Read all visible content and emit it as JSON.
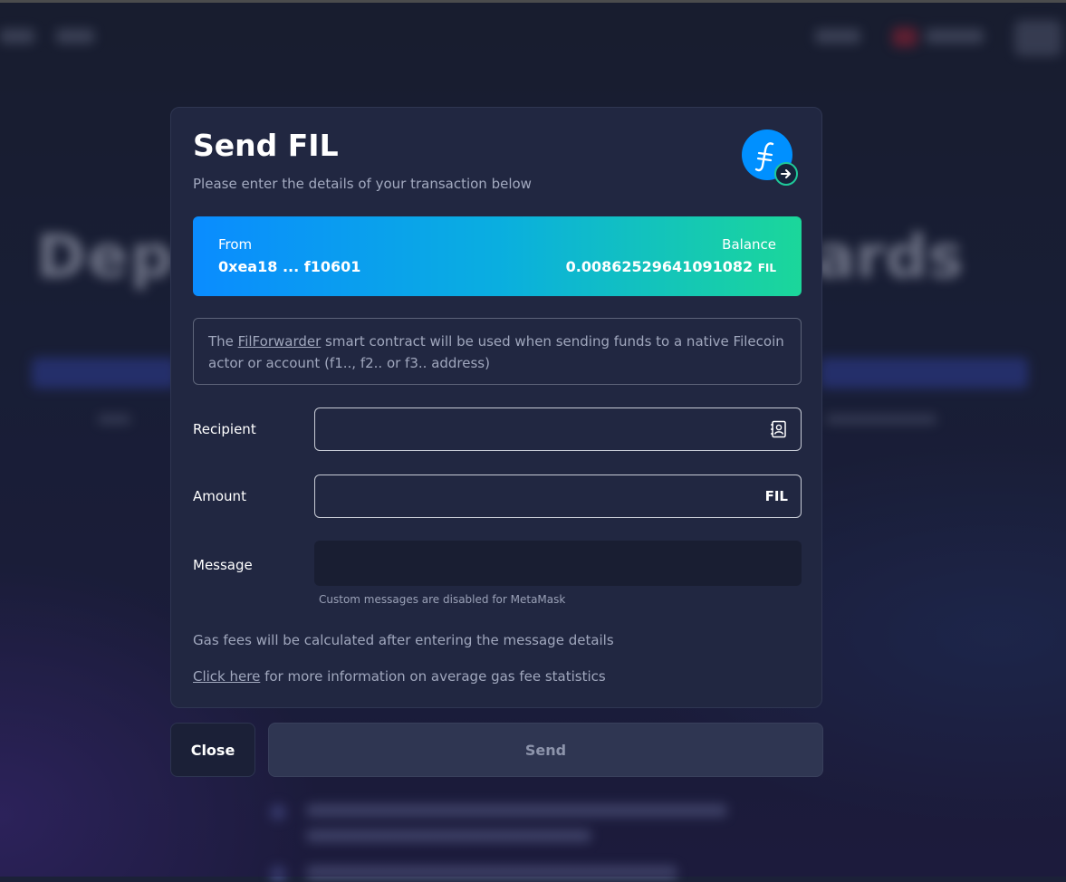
{
  "modal": {
    "title": "Send FIL",
    "subtitle": "Please enter the details of your transaction below"
  },
  "balance_card": {
    "from_label": "From",
    "from_value": "0xea18 ... f10601",
    "balance_label": "Balance",
    "balance_value": "0.00862529641091082",
    "balance_unit": "FIL"
  },
  "notice": {
    "prefix": "The ",
    "link": "FilForwarder",
    "suffix": " smart contract will be used when sending funds to a native Filecoin actor or account (f1.., f2.. or f3.. address)"
  },
  "form": {
    "recipient_label": "Recipient",
    "recipient_value": "",
    "amount_label": "Amount",
    "amount_value": "",
    "amount_unit": "FIL",
    "message_label": "Message",
    "message_helper": "Custom messages are disabled for MetaMask"
  },
  "gas": {
    "note": "Gas fees will be calculated after entering the message details",
    "link": "Click here",
    "link_suffix": " for more information on average gas fee statistics"
  },
  "buttons": {
    "close": "Close",
    "send": "Send"
  },
  "colors": {
    "modal_bg": "#212741",
    "gradient_start": "#0a8cff",
    "gradient_end": "#1bd79a",
    "filecoin_blue": "#0090ff",
    "badge_green": "#1fc99a"
  },
  "icons": {
    "logo": "filecoin-logo-icon",
    "badge": "arrow-right-circle-icon",
    "recipient": "address-book-icon"
  }
}
